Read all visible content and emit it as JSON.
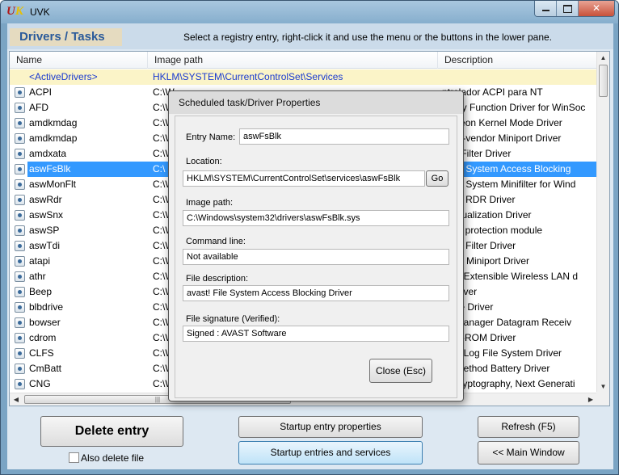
{
  "window": {
    "title": "UVK",
    "logo_text": "UVK"
  },
  "header": {
    "section_title": "Drivers / Tasks",
    "instruction": "Select a registry entry, right-click it and use the menu or the buttons in the lower pane."
  },
  "list": {
    "columns": [
      "Name",
      "Image path",
      "Description"
    ],
    "active_row": {
      "name": "<ActiveDrivers>",
      "path": "HKLM\\SYSTEM\\CurrentControlSet\\Services",
      "desc": ""
    },
    "rows": [
      {
        "name": "ACPI",
        "path": "C:\\W",
        "desc": "ntrolador ACPI para NT",
        "selected": false
      },
      {
        "name": "AFD",
        "path": "C:\\W",
        "desc": "cillary Function Driver for WinSoc",
        "selected": false
      },
      {
        "name": "amdkmdag",
        "path": "C:\\W",
        "desc": "Radeon Kernel Mode Driver",
        "selected": false
      },
      {
        "name": "amdkmdap",
        "path": "C:\\W",
        "desc": "multi-vendor Miniport Driver",
        "selected": false
      },
      {
        "name": "amdxata",
        "path": "C:\\W",
        "desc": "age Filter Driver",
        "selected": false
      },
      {
        "name": "aswFsBlk",
        "path": "C:\\",
        "desc": "! File System Access Blocking",
        "selected": true
      },
      {
        "name": "aswMonFlt",
        "path": "C:\\W",
        "desc": "! File System Minifilter for Wind",
        "selected": false
      },
      {
        "name": "aswRdr",
        "path": "C:\\W",
        "desc": "! TDI RDR Driver",
        "selected": false
      },
      {
        "name": "aswSnx",
        "path": "C:\\W",
        "desc": "! Virtualization Driver",
        "selected": false
      },
      {
        "name": "aswSP",
        "path": "C:\\W",
        "desc": "! self protection module",
        "selected": false
      },
      {
        "name": "aswTdi",
        "path": "C:\\W",
        "desc": "! TDI Filter Driver",
        "selected": false
      },
      {
        "name": "atapi",
        "path": "C:\\W",
        "desc": "I IDE Miniport Driver",
        "selected": false
      },
      {
        "name": "athr",
        "path": "C:\\W",
        "desc": "eros Extensible Wireless LAN d",
        "selected": false
      },
      {
        "name": "Beep",
        "path": "C:\\W",
        "desc": "P Driver",
        "selected": false
      },
      {
        "name": "blbdrive",
        "path": "C:\\W",
        "desc": "Drive Driver",
        "selected": false
      },
      {
        "name": "bowser",
        "path": "C:\\W",
        "desc": "an Manager Datagram Receiv",
        "selected": false
      },
      {
        "name": "cdrom",
        "path": "C:\\W",
        "desc": "I CD-ROM Driver",
        "selected": false
      },
      {
        "name": "CLFS",
        "path": "C:\\W",
        "desc": "mon Log File System Driver",
        "selected": false
      },
      {
        "name": "CmBatt",
        "path": "C:\\W",
        "desc": "rol Method Battery Driver",
        "selected": false
      },
      {
        "name": "CNG",
        "path": "C:\\W",
        "desc": "el Cryptography, Next Generati",
        "selected": false
      }
    ]
  },
  "dialog": {
    "title": "Scheduled task/Driver Properties",
    "entry_name_label": "Entry Name:",
    "entry_name_value": "aswFsBlk",
    "location_label": "Location:",
    "location_value": "HKLM\\SYSTEM\\CurrentControlSet\\services\\aswFsBlk",
    "go_label": "Go",
    "image_path_label": "Image path:",
    "image_path_value": "C:\\Windows\\system32\\drivers\\aswFsBlk.sys",
    "command_line_label": "Command line:",
    "command_line_value": "Not available",
    "file_desc_label": "File description:",
    "file_desc_value": "avast! File System Access Blocking Driver",
    "signature_label": "File signature (Verified):",
    "signature_value": "Signed :  AVAST Software",
    "close_label": "Close (Esc)"
  },
  "buttons": {
    "delete_entry": "Delete entry",
    "also_delete_file": "Also delete file",
    "startup_entry_properties": "Startup entry properties",
    "startup_entries_services": "Startup entries and services",
    "refresh": "Refresh (F5)",
    "main_window": "<< Main Window"
  },
  "colors": {
    "selection": "#3399ff",
    "active_row_bg": "#fbf4c8",
    "section_title": "#2a5a9a"
  }
}
